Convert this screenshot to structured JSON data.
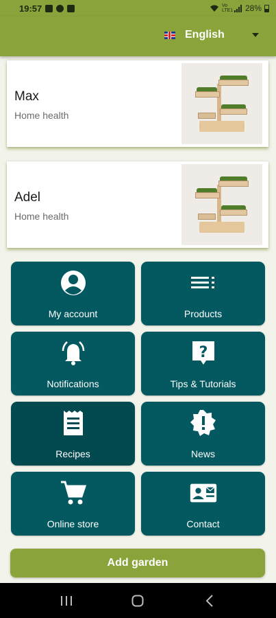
{
  "status_bar": {
    "time": "19:57",
    "network": "Vo LTE1",
    "battery": "28%"
  },
  "header": {
    "language": "English",
    "language_flag": "uk-flag-icon"
  },
  "gardens": [
    {
      "name": "Max",
      "type": "Home health"
    },
    {
      "name": "Adel",
      "type": "Home health"
    }
  ],
  "menu": {
    "my_account": "My account",
    "products": "Products",
    "notifications": "Notifications",
    "tips": "Tips & Tutorials",
    "recipes": "Recipes",
    "news": "News",
    "online_store": "Online store",
    "contact": "Contact"
  },
  "add_garden_label": "Add garden",
  "colors": {
    "brand_green": "#8aa43b",
    "tile_teal": "#03595f",
    "background": "#f2f3ea"
  }
}
